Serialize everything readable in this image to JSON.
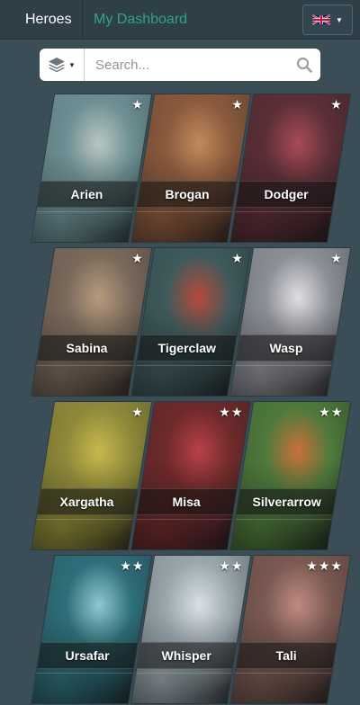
{
  "nav": {
    "heroes_label": "Heroes",
    "dashboard_label": "My Dashboard",
    "language_icon": "uk-flag-icon"
  },
  "search": {
    "placeholder": "Search...",
    "filter_icon": "layers-icon"
  },
  "colors": {
    "background": "#3b4e57",
    "nav_background": "#2f3f47",
    "accent": "#2fa389"
  },
  "heroes": [
    [
      {
        "name": "Arien",
        "stars": "★",
        "palette": [
          "#6e8f93",
          "#2f4a4e",
          "#b9c6c0"
        ]
      },
      {
        "name": "Brogan",
        "stars": "★",
        "palette": [
          "#8a5a3d",
          "#3b2a22",
          "#c28a5c"
        ]
      },
      {
        "name": "Dodger",
        "stars": "★",
        "palette": [
          "#5c2f37",
          "#2a1e22",
          "#a84b55"
        ]
      }
    ],
    [
      {
        "name": "Sabina",
        "stars": "★",
        "palette": [
          "#7a6a5c",
          "#3a2f2a",
          "#b89a7c"
        ]
      },
      {
        "name": "Tigerclaw",
        "stars": "★",
        "palette": [
          "#3f5a5c",
          "#1f2c2e",
          "#b54a3a"
        ]
      },
      {
        "name": "Wasp",
        "stars": "★",
        "palette": [
          "#8d8f96",
          "#3b3c44",
          "#dedfe4"
        ]
      }
    ],
    [
      {
        "name": "Xargatha",
        "stars": "★",
        "palette": [
          "#8f8a3a",
          "#3e3b1c",
          "#c8b84e"
        ]
      },
      {
        "name": "Misa",
        "stars": "★★",
        "palette": [
          "#6f2a2a",
          "#2b1d25",
          "#b8404a"
        ]
      },
      {
        "name": "Silverarrow",
        "stars": "★★",
        "palette": [
          "#4f7a3c",
          "#1e3020",
          "#c9703a"
        ]
      }
    ],
    [
      {
        "name": "Ursafar",
        "stars": "★★",
        "palette": [
          "#2f6f7a",
          "#183238",
          "#8ec8d0"
        ]
      },
      {
        "name": "Whisper",
        "stars": "★★",
        "palette": [
          "#9aa7ad",
          "#2e3438",
          "#d9e0e3"
        ]
      },
      {
        "name": "Tali",
        "stars": "★★★",
        "palette": [
          "#7a5a52",
          "#3a2c2a",
          "#c08a82"
        ]
      }
    ]
  ]
}
